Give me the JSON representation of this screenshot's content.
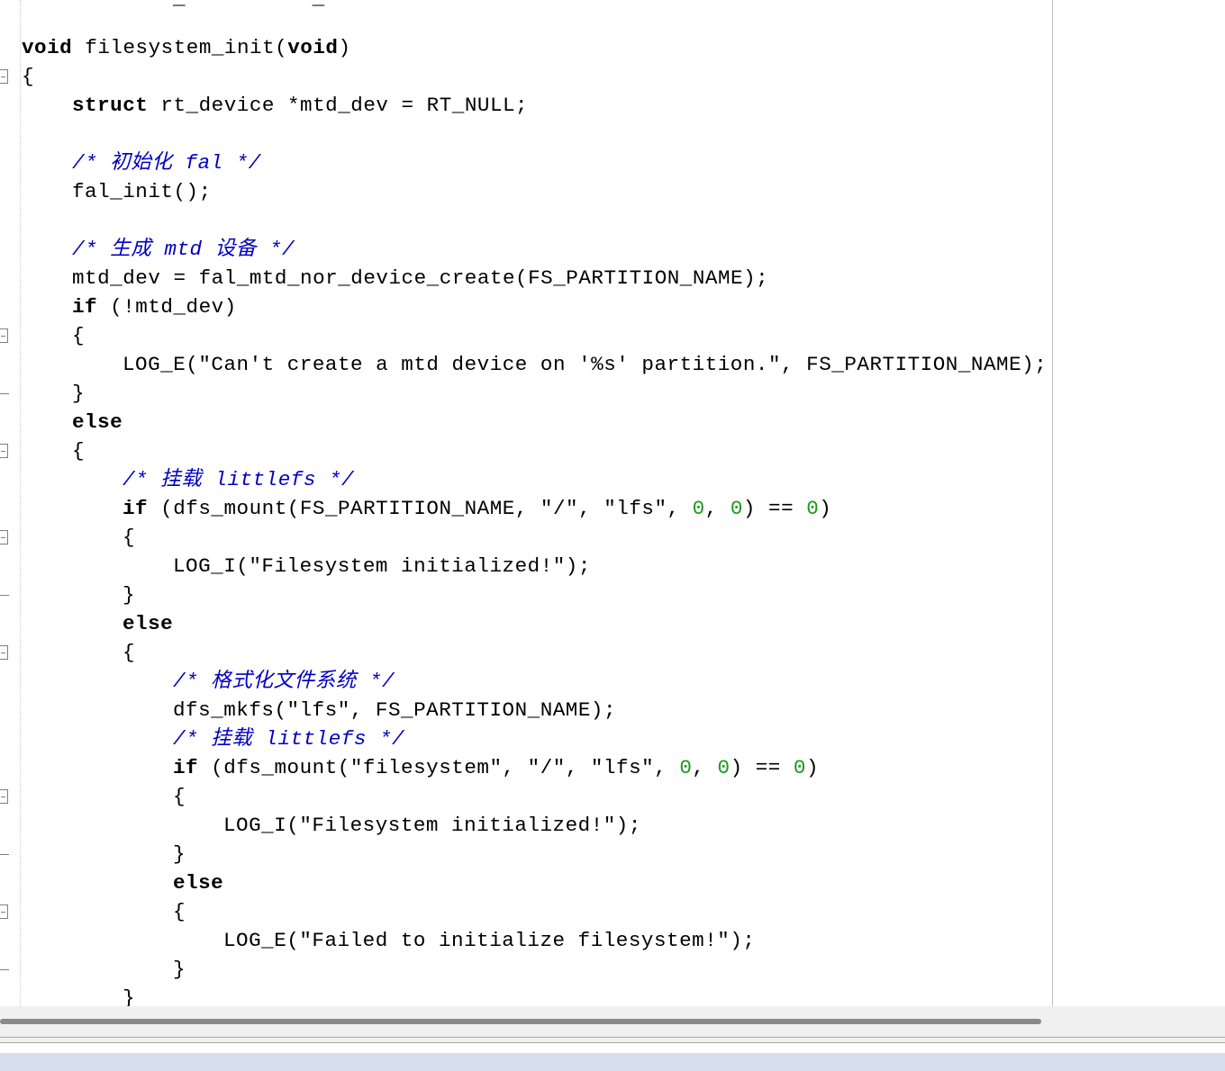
{
  "editor": {
    "partial_top_line": "_          _",
    "lines": [
      {
        "indent": 0,
        "parts": [
          {
            "t": "void",
            "c": "kw"
          },
          {
            "t": " filesystem_init("
          },
          {
            "t": "void",
            "c": "kw"
          },
          {
            "t": ")"
          }
        ]
      },
      {
        "indent": 0,
        "parts": [
          {
            "t": "{"
          }
        ]
      },
      {
        "indent": 1,
        "parts": [
          {
            "t": "struct",
            "c": "kw"
          },
          {
            "t": " rt_device *mtd_dev = RT_NULL;"
          }
        ]
      },
      {
        "indent": 0,
        "parts": []
      },
      {
        "indent": 1,
        "parts": [
          {
            "t": "/* 初始化 fal */",
            "c": "cm"
          }
        ]
      },
      {
        "indent": 1,
        "parts": [
          {
            "t": "fal_init();"
          }
        ]
      },
      {
        "indent": 0,
        "parts": []
      },
      {
        "indent": 1,
        "parts": [
          {
            "t": "/* 生成 mtd 设备 */",
            "c": "cm"
          }
        ]
      },
      {
        "indent": 1,
        "parts": [
          {
            "t": "mtd_dev = fal_mtd_nor_device_create(FS_PARTITION_NAME);"
          }
        ]
      },
      {
        "indent": 1,
        "parts": [
          {
            "t": "if",
            "c": "kw"
          },
          {
            "t": " (!mtd_dev)"
          }
        ]
      },
      {
        "indent": 1,
        "parts": [
          {
            "t": "{"
          }
        ]
      },
      {
        "indent": 2,
        "parts": [
          {
            "t": "LOG_E(\"Can't create a mtd device on '%s' partition.\", FS_PARTITION_NAME);"
          }
        ]
      },
      {
        "indent": 1,
        "parts": [
          {
            "t": "}"
          }
        ]
      },
      {
        "indent": 1,
        "parts": [
          {
            "t": "else",
            "c": "kw"
          }
        ]
      },
      {
        "indent": 1,
        "parts": [
          {
            "t": "{"
          }
        ]
      },
      {
        "indent": 2,
        "parts": [
          {
            "t": "/* 挂载 littlefs */",
            "c": "cm"
          }
        ]
      },
      {
        "indent": 2,
        "parts": [
          {
            "t": "if",
            "c": "kw"
          },
          {
            "t": " (dfs_mount(FS_PARTITION_NAME, \"/\", \"lfs\", "
          },
          {
            "t": "0",
            "c": "num"
          },
          {
            "t": ", "
          },
          {
            "t": "0",
            "c": "num"
          },
          {
            "t": ") == "
          },
          {
            "t": "0",
            "c": "num"
          },
          {
            "t": ")"
          }
        ]
      },
      {
        "indent": 2,
        "parts": [
          {
            "t": "{"
          }
        ]
      },
      {
        "indent": 3,
        "parts": [
          {
            "t": "LOG_I(\"Filesystem initialized!\");"
          }
        ]
      },
      {
        "indent": 2,
        "parts": [
          {
            "t": "}"
          }
        ]
      },
      {
        "indent": 2,
        "parts": [
          {
            "t": "else",
            "c": "kw"
          }
        ]
      },
      {
        "indent": 2,
        "parts": [
          {
            "t": "{"
          }
        ]
      },
      {
        "indent": 3,
        "parts": [
          {
            "t": "/* 格式化文件系统 */",
            "c": "cm"
          }
        ]
      },
      {
        "indent": 3,
        "parts": [
          {
            "t": "dfs_mkfs(\"lfs\", FS_PARTITION_NAME);"
          }
        ]
      },
      {
        "indent": 3,
        "parts": [
          {
            "t": "/* 挂载 littlefs */",
            "c": "cm"
          }
        ]
      },
      {
        "indent": 3,
        "parts": [
          {
            "t": "if",
            "c": "kw"
          },
          {
            "t": " (dfs_mount(\"filesystem\", \"/\", \"lfs\", "
          },
          {
            "t": "0",
            "c": "num"
          },
          {
            "t": ", "
          },
          {
            "t": "0",
            "c": "num"
          },
          {
            "t": ") == "
          },
          {
            "t": "0",
            "c": "num"
          },
          {
            "t": ")"
          }
        ]
      },
      {
        "indent": 3,
        "parts": [
          {
            "t": "{"
          }
        ]
      },
      {
        "indent": 4,
        "parts": [
          {
            "t": "LOG_I(\"Filesystem initialized!\");"
          }
        ]
      },
      {
        "indent": 3,
        "parts": [
          {
            "t": "}"
          }
        ]
      },
      {
        "indent": 3,
        "parts": [
          {
            "t": "else",
            "c": "kw"
          }
        ]
      },
      {
        "indent": 3,
        "parts": [
          {
            "t": "{"
          }
        ]
      },
      {
        "indent": 4,
        "parts": [
          {
            "t": "LOG_E(\"Failed to initialize filesystem!\");"
          }
        ]
      },
      {
        "indent": 3,
        "parts": [
          {
            "t": "}"
          }
        ]
      },
      {
        "indent": 2,
        "parts": [
          {
            "t": "}"
          }
        ]
      }
    ]
  },
  "fold_markers": {
    "open_rows": [
      1,
      10,
      14,
      17,
      21,
      26,
      30
    ],
    "close_rows": [
      12,
      19,
      28,
      32
    ]
  },
  "colors": {
    "keyword": "#000000",
    "comment": "#0000c0",
    "number": "#1a9b1a",
    "text": "#000000"
  }
}
